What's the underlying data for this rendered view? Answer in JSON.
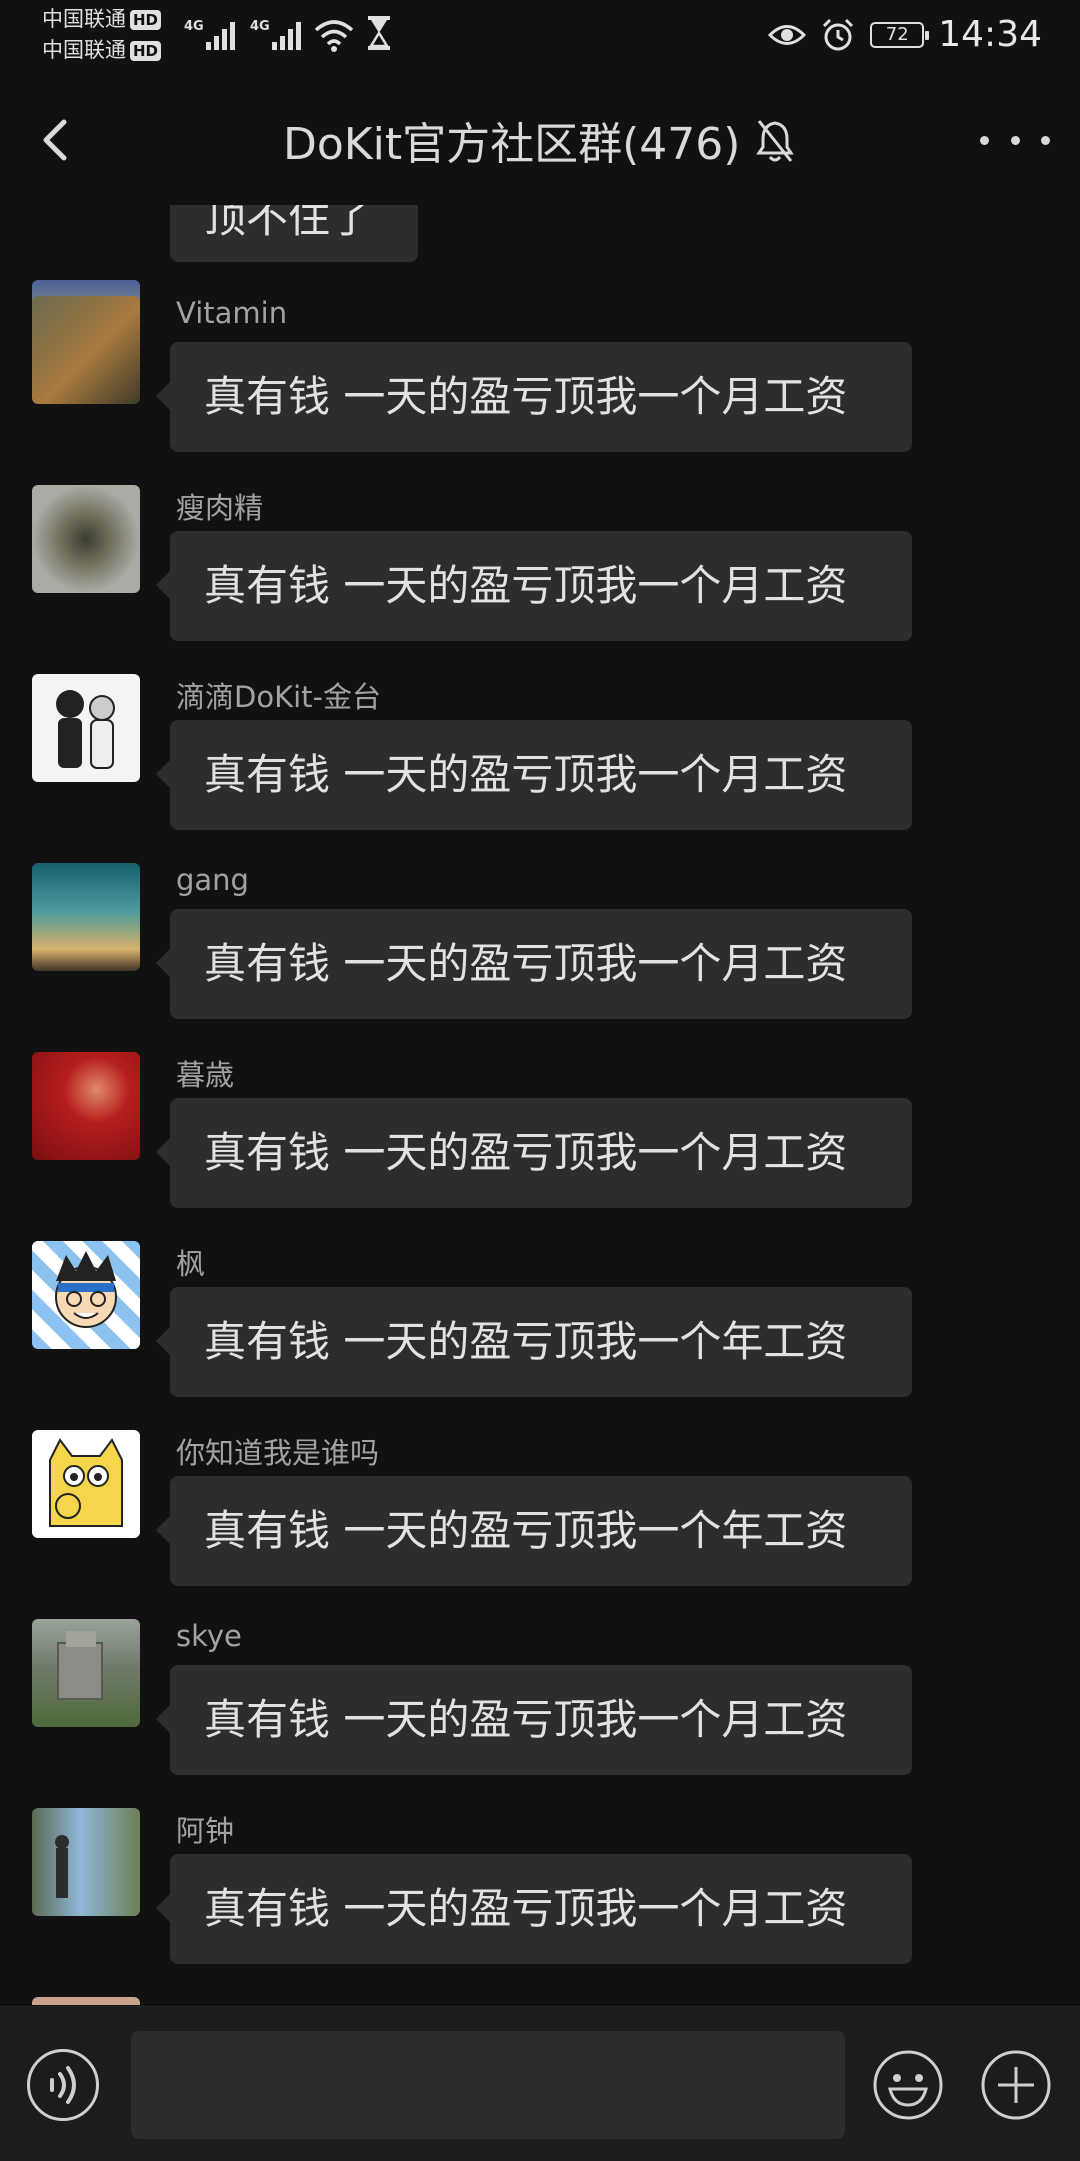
{
  "status_bar": {
    "carrier_1": "中国联通",
    "carrier_2": "中国联通",
    "hd_badge": "HD",
    "network_1": "4G",
    "network_2": "4G",
    "battery": "72",
    "time": "14:34"
  },
  "header": {
    "title": "DoKit官方社区群(476)",
    "back_icon": "chevron-left-icon",
    "mute_icon": "bell-off-icon",
    "more_icon": "more-dots-icon"
  },
  "partial_message": {
    "text": "顶不住了"
  },
  "messages": [
    {
      "name": "Vitamin",
      "text": "真有钱 一天的盈亏顶我一个月工资",
      "avatar_colors": [
        "#6b6a4e",
        "#a87a3f"
      ]
    },
    {
      "name": "瘦肉精",
      "text": "真有钱 一天的盈亏顶我一个月工资",
      "avatar_colors": [
        "#8a8f86",
        "#3b3d33"
      ]
    },
    {
      "name": "滴滴DoKit-金台",
      "text": "真有钱 一天的盈亏顶我一个月工资",
      "avatar_colors": [
        "#ffffff",
        "#222222"
      ]
    },
    {
      "name": "gang",
      "text": "真有钱 一天的盈亏顶我一个月工资",
      "avatar_colors": [
        "#1d6f7c",
        "#d8b06a"
      ]
    },
    {
      "name": "暮歳",
      "text": "真有钱 一天的盈亏顶我一个月工资",
      "avatar_colors": [
        "#b51c1c",
        "#e08a6a"
      ]
    },
    {
      "name": "枫",
      "text": "真有钱 一天的盈亏顶我一个年工资",
      "avatar_colors": [
        "#3a7dd1",
        "#f1f1f1"
      ]
    },
    {
      "name": "你知道我是谁吗",
      "text": "真有钱 一天的盈亏顶我一个年工资",
      "avatar_colors": [
        "#f5d54a",
        "#ffffff"
      ]
    },
    {
      "name": "skye",
      "text": "真有钱 一天的盈亏顶我一个月工资",
      "avatar_colors": [
        "#5d6a52",
        "#9aa39b"
      ]
    },
    {
      "name": "阿钟",
      "text": "真有钱 一天的盈亏顶我一个月工资",
      "avatar_colors": [
        "#4f8fc4",
        "#6c7f55"
      ]
    }
  ],
  "bottom_bar": {
    "voice_icon": "voice-icon",
    "emoji_icon": "emoji-icon",
    "plus_icon": "plus-icon",
    "input_value": ""
  }
}
